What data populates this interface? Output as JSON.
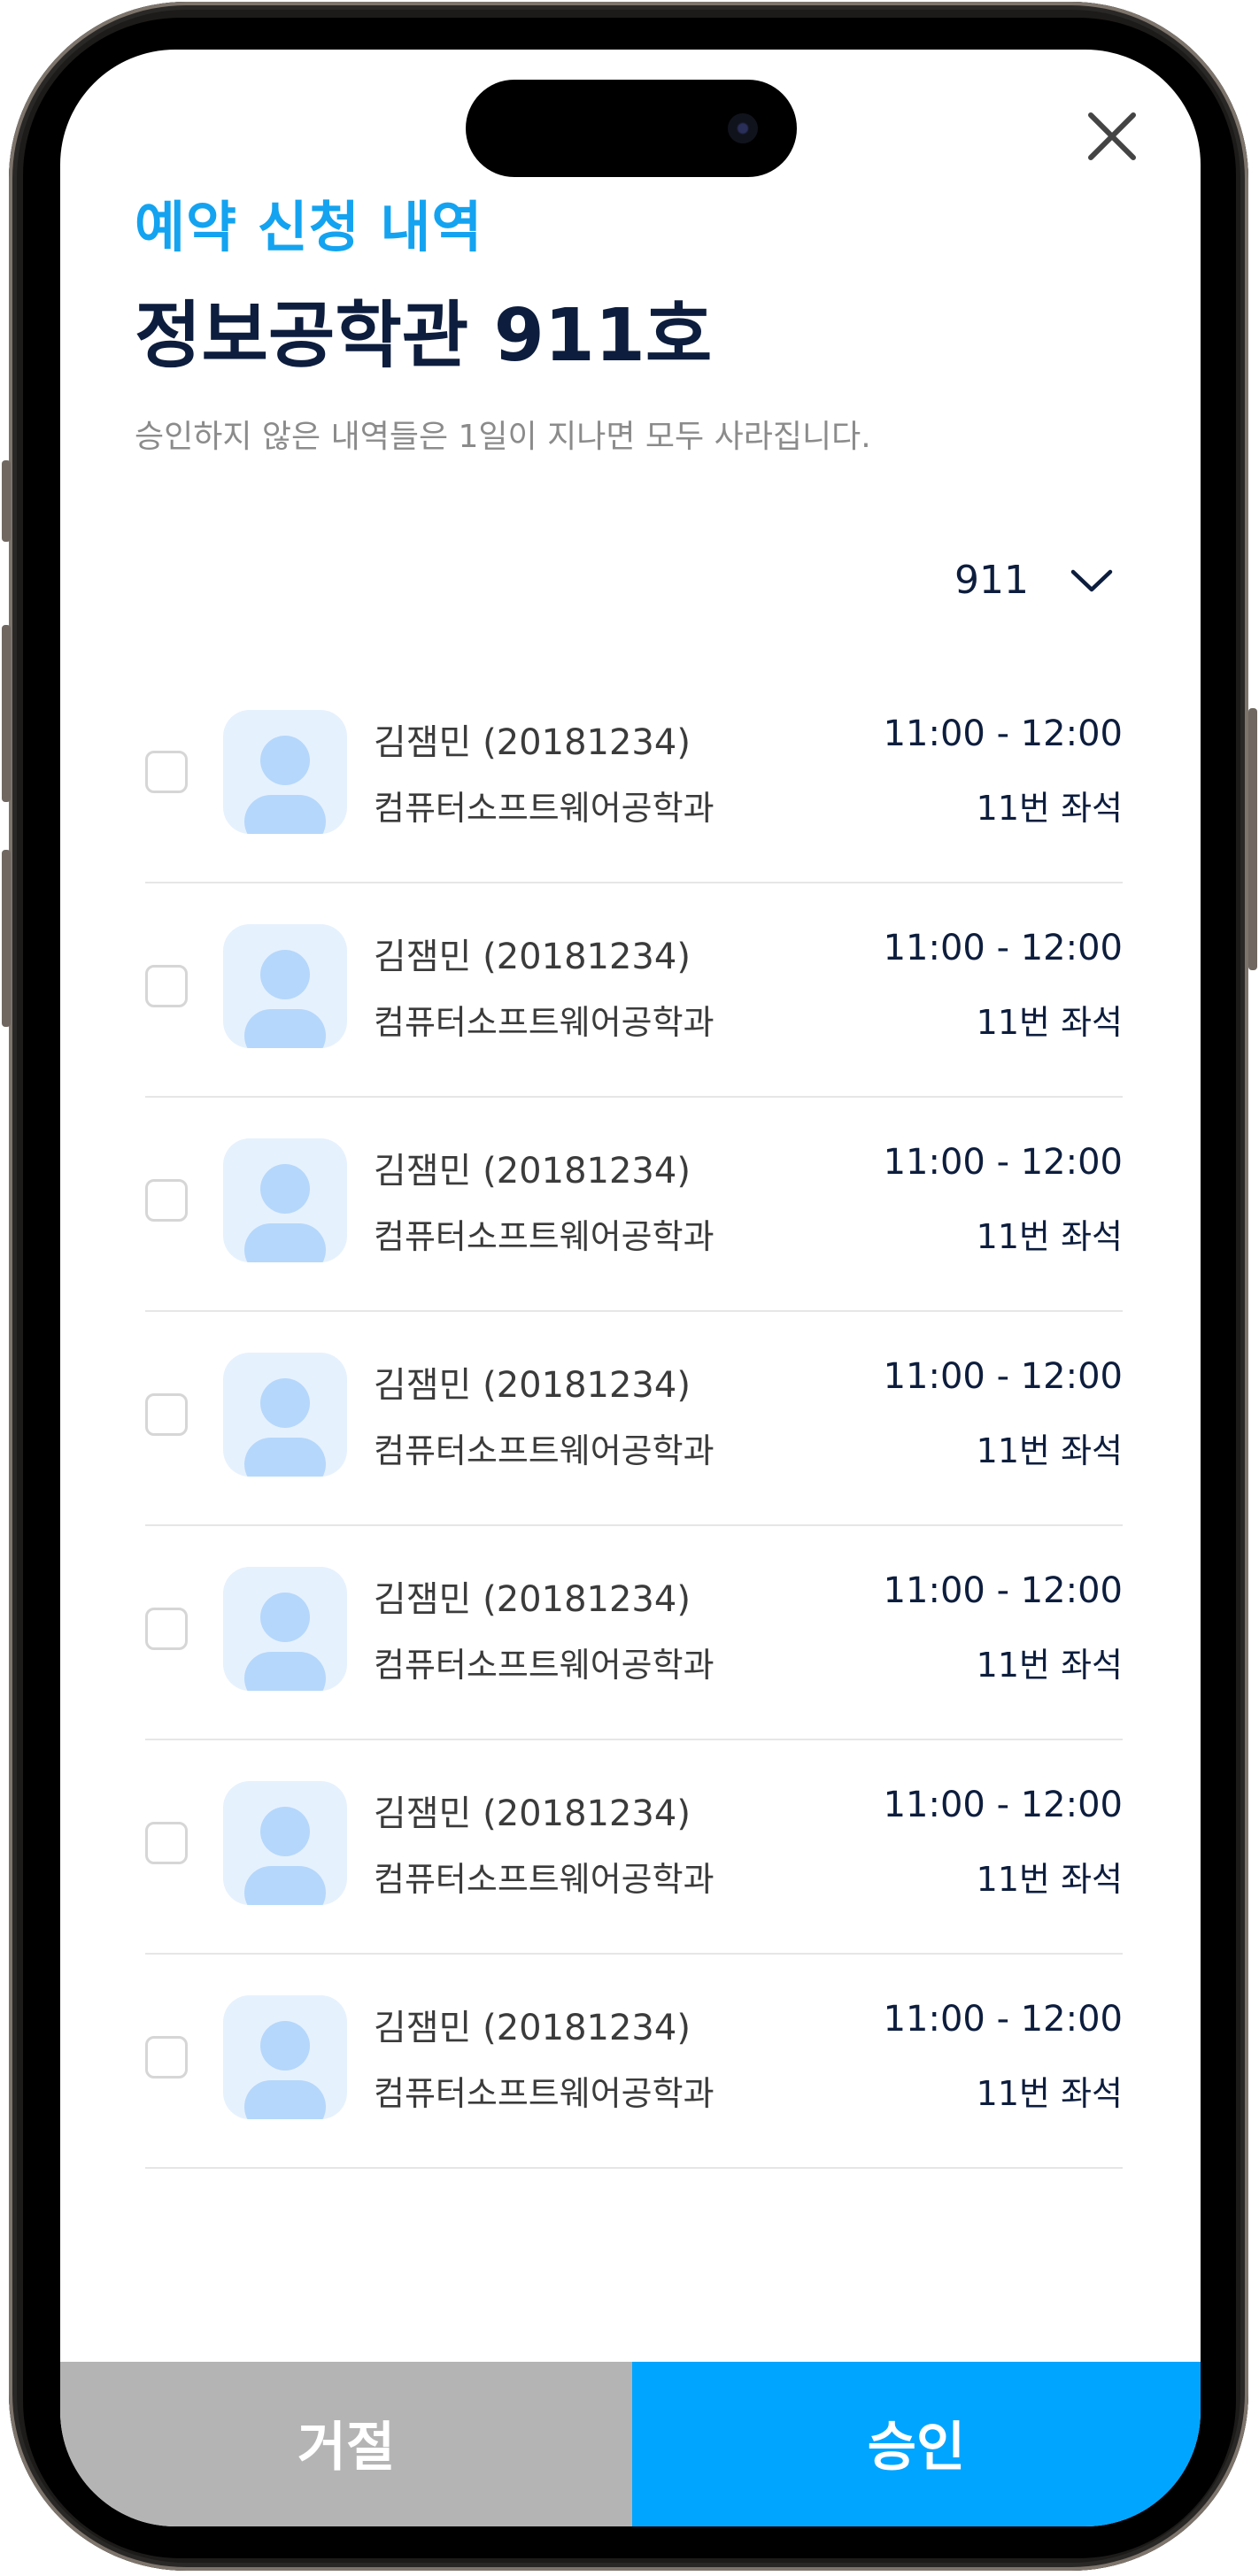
{
  "header": {
    "eyebrow": "예약 신청 내역",
    "title": "정보공학관 911호",
    "notice": "승인하지 않은 내역들은 1일이 지나면 모두 사라집니다."
  },
  "room_select": {
    "value": "911",
    "icon": "chevron-down-icon"
  },
  "close": {
    "icon": "close-icon"
  },
  "requests": [
    {
      "name": "김잼민 (20181234)",
      "dept": "컴퓨터소프트웨어공학과",
      "time": "11:00 - 12:00",
      "seat": "11번 좌석",
      "checked": false
    },
    {
      "name": "김잼민 (20181234)",
      "dept": "컴퓨터소프트웨어공학과",
      "time": "11:00 - 12:00",
      "seat": "11번 좌석",
      "checked": false
    },
    {
      "name": "김잼민 (20181234)",
      "dept": "컴퓨터소프트웨어공학과",
      "time": "11:00 - 12:00",
      "seat": "11번 좌석",
      "checked": false
    },
    {
      "name": "김잼민 (20181234)",
      "dept": "컴퓨터소프트웨어공학과",
      "time": "11:00 - 12:00",
      "seat": "11번 좌석",
      "checked": false
    },
    {
      "name": "김잼민 (20181234)",
      "dept": "컴퓨터소프트웨어공학과",
      "time": "11:00 - 12:00",
      "seat": "11번 좌석",
      "checked": false
    },
    {
      "name": "김잼민 (20181234)",
      "dept": "컴퓨터소프트웨어공학과",
      "time": "11:00 - 12:00",
      "seat": "11번 좌석",
      "checked": false
    },
    {
      "name": "김잼민 (20181234)",
      "dept": "컴퓨터소프트웨어공학과",
      "time": "11:00 - 12:00",
      "seat": "11번 좌석",
      "checked": false
    }
  ],
  "actions": {
    "reject_label": "거절",
    "approve_label": "승인"
  },
  "colors": {
    "accent": "#00a5ff",
    "eyebrow": "#14a3f0",
    "title": "#0d1d3d",
    "reject": "#b4b4b4",
    "avatar_bg": "#e6f1fe",
    "avatar_fg": "#b5d7fb"
  }
}
